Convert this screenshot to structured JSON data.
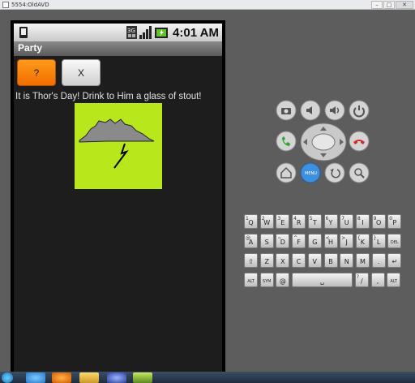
{
  "window": {
    "title": "5554:OldAVD"
  },
  "statusbar": {
    "network": "3G",
    "time": "4:01 AM"
  },
  "app": {
    "title": "Party"
  },
  "buttons": {
    "question": "?",
    "close": "X"
  },
  "message": "It is Thor's Day! Drink to Him a glass of stout!",
  "image": {
    "background": "#b8e81c",
    "cloud": "#8a8a8a",
    "bolt": "#000000"
  },
  "keyboard": {
    "row1": [
      {
        "k": "Q",
        "s": "1"
      },
      {
        "k": "W",
        "s": "2"
      },
      {
        "k": "E",
        "s": "3"
      },
      {
        "k": "R",
        "s": "4"
      },
      {
        "k": "T",
        "s": "5"
      },
      {
        "k": "Y",
        "s": "6"
      },
      {
        "k": "U",
        "s": "7"
      },
      {
        "k": "I",
        "s": "8"
      },
      {
        "k": "O",
        "s": "9"
      },
      {
        "k": "P",
        "s": "0"
      }
    ],
    "row2": [
      {
        "k": "A",
        "s": "@"
      },
      {
        "k": "S",
        "s": ""
      },
      {
        "k": "D",
        "s": "~"
      },
      {
        "k": "F",
        "s": "^"
      },
      {
        "k": "G",
        "s": ""
      },
      {
        "k": "H",
        "s": "<"
      },
      {
        "k": "J",
        "s": ">"
      },
      {
        "k": "K",
        "s": "{"
      },
      {
        "k": "L",
        "s": "}"
      },
      {
        "k": "DEL",
        "s": ""
      }
    ],
    "row3": [
      {
        "k": "⇧",
        "s": ""
      },
      {
        "k": "Z",
        "s": ""
      },
      {
        "k": "X",
        "s": ""
      },
      {
        "k": "C",
        "s": ""
      },
      {
        "k": "V",
        "s": ""
      },
      {
        "k": "B",
        "s": ""
      },
      {
        "k": "N",
        "s": ""
      },
      {
        "k": "M",
        "s": ""
      },
      {
        "k": ".",
        "s": ""
      },
      {
        "k": "↵",
        "s": ""
      }
    ],
    "row4": [
      {
        "k": "ALT",
        "s": ""
      },
      {
        "k": "SYM",
        "s": ""
      },
      {
        "k": "@",
        "s": ""
      },
      {
        "k": "␣",
        "s": ""
      },
      {
        "k": "/",
        "s": "?"
      },
      {
        "k": ",",
        "s": ""
      },
      {
        "k": "ALT",
        "s": ""
      }
    ]
  },
  "colors": {
    "accent_orange": "#f57e00",
    "call_green": "#2aa52a",
    "end_red": "#d42a2a",
    "menu_blue": "#3d8fe0"
  }
}
